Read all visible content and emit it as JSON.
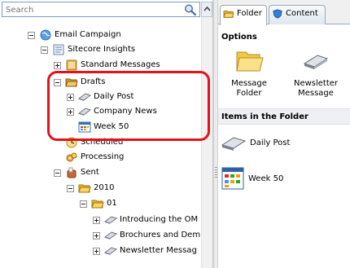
{
  "search": {
    "placeholder": "Search"
  },
  "tree": {
    "root": "Email Campaign",
    "sitecore_insights": "Sitecore Insights",
    "standard_messages": "Standard Messages",
    "drafts": "Drafts",
    "daily_post": "Daily Post",
    "company_news": "Company News",
    "week50": "Week 50",
    "scheduled": "Scheduled",
    "processing": "Processing",
    "sent": "Sent",
    "year": "2010",
    "month": "01",
    "msg1": "Introducing the OM",
    "msg2": "Brochures and Dem",
    "msg3": "Newsletter Messag"
  },
  "tabs": [
    {
      "label": "Folder"
    },
    {
      "label": "Content"
    }
  ],
  "options": {
    "header": "Options",
    "message_folder": "Message Folder",
    "newsletter_message": "Newsletter Message"
  },
  "items": {
    "header": "Items in the Folder",
    "daily_post": "Daily Post",
    "week50": "Week 50"
  },
  "colors": {
    "highlight": "#e3121d",
    "folder": "#f7c844",
    "selection_border": "#9da9b8"
  }
}
